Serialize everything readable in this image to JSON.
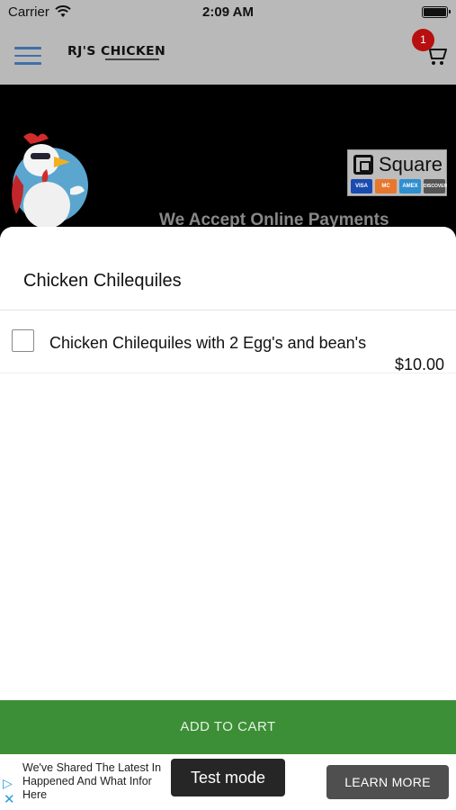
{
  "status_bar": {
    "carrier": "Carrier",
    "time": "2:09 AM"
  },
  "header": {
    "logo_text": "RJ'S CHICKEN",
    "cart_count": "1",
    "menu_icon": "hamburger-menu-icon",
    "cart_icon": "shopping-cart-icon"
  },
  "banner": {
    "square_text": "Square",
    "cards": [
      "VISA",
      "MC",
      "AMEX",
      "DISCOVER"
    ],
    "tagline": "We Accept Online Payments"
  },
  "sheet": {
    "title": "Chicken Chilequiles",
    "options": [
      {
        "name": "Chicken Chilequiles with 2 Egg's and bean's",
        "price": "$10.00",
        "checked": false
      }
    ]
  },
  "add_to_cart_label": "ADD TO CART",
  "ad": {
    "line1": "We've Shared The Latest In",
    "line2": "Happened And What Infor",
    "line3": "Here",
    "test_mode_label": "Test mode",
    "learn_more_label": "LEARN MORE"
  },
  "colors": {
    "accent_green": "#3c8f36",
    "badge_red": "#b80f10",
    "menu_blue": "#3f6fa8"
  }
}
